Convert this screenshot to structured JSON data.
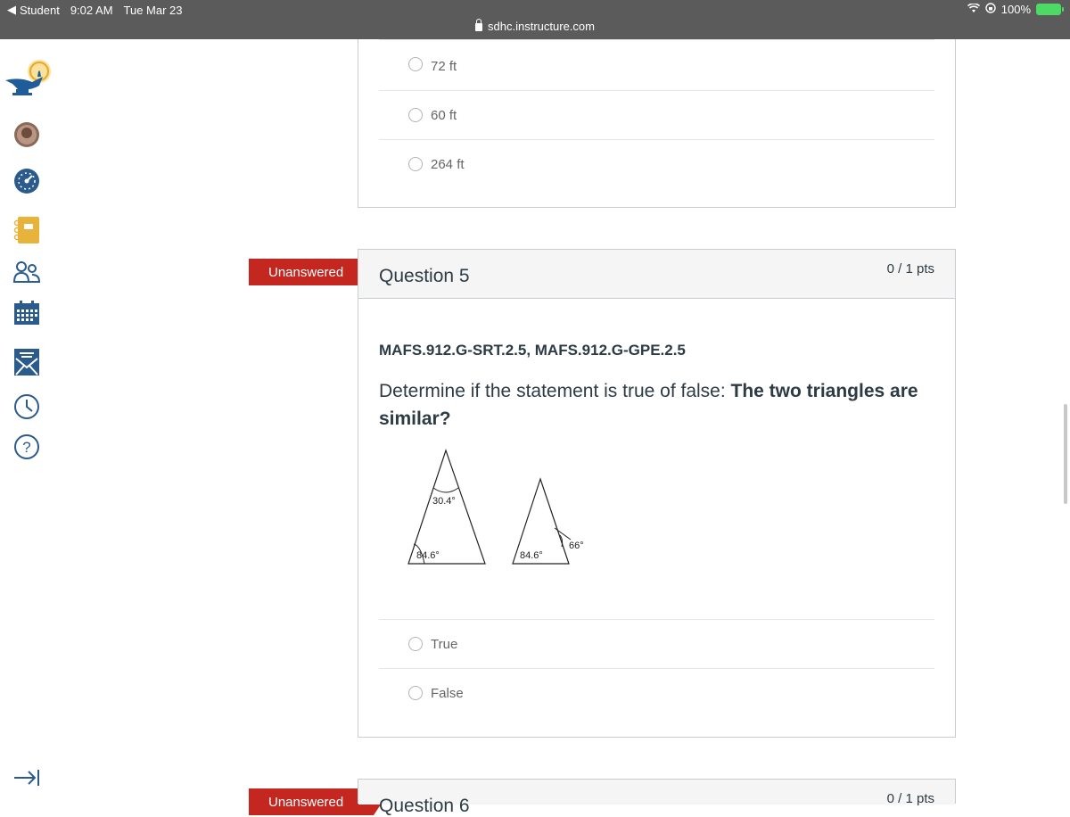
{
  "status_bar": {
    "back_app": "Student",
    "time": "9:02 AM",
    "date": "Tue Mar 23",
    "battery": "100%"
  },
  "url": "sdhc.instructure.com",
  "nav": {
    "icons": [
      "lamp-logo-icon",
      "avatar",
      "dashboard-icon",
      "courses-icon",
      "groups-icon",
      "calendar-icon",
      "inbox-icon",
      "history-icon",
      "help-icon",
      "collapse-icon"
    ]
  },
  "question4": {
    "answers": [
      "72 ft",
      "60 ft",
      "264 ft"
    ]
  },
  "question5": {
    "status": "Unanswered",
    "title": "Question 5",
    "points": "0 / 1 pts",
    "standards": "MAFS.912.G-SRT.2.5, MAFS.912.G-GPE.2.5",
    "prompt_plain": "Determine if the statement is true of false: ",
    "prompt_bold": "The two triangles are similar?",
    "figure": {
      "triangle1_top_angle": "30.4°",
      "triangle1_left_angle": "84.6°",
      "triangle2_left_angle": "84.6°",
      "triangle2_exterior_angle": "66°"
    },
    "answers": [
      "True",
      "False"
    ]
  },
  "question6": {
    "status": "Unanswered",
    "title": "Question 6",
    "points": "0 / 1 pts"
  },
  "colors": {
    "flag_red": "#c3271f",
    "text": "#2d3b45",
    "nav_blue": "#2b5a8c",
    "nav_gold": "#e8b33a"
  }
}
